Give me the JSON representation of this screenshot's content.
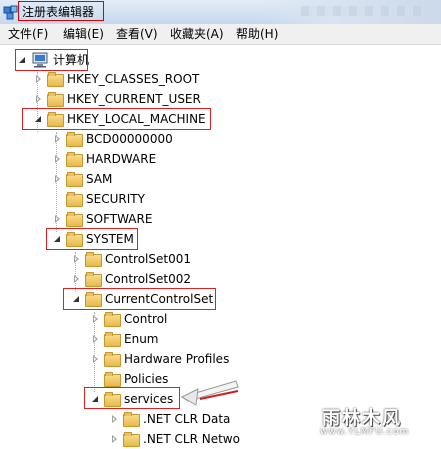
{
  "window": {
    "title": "注册表编辑器"
  },
  "menu": {
    "file": "文件(F)",
    "edit": "编辑(E)",
    "view": "查看(V)",
    "favorites": "收藏夹(A)",
    "help": "帮助(H)"
  },
  "tree": {
    "root": "计算机",
    "hkcr": "HKEY_CLASSES_ROOT",
    "hkcu": "HKEY_CURRENT_USER",
    "hklm": "HKEY_LOCAL_MACHINE",
    "hklm_children": {
      "bcd": "BCD00000000",
      "hardware": "HARDWARE",
      "sam": "SAM",
      "security": "SECURITY",
      "software": "SOFTWARE",
      "system": "SYSTEM"
    },
    "system_children": {
      "cs001": "ControlSet001",
      "cs002": "ControlSet002",
      "ccs": "CurrentControlSet"
    },
    "ccs_children": {
      "control": "Control",
      "enum": "Enum",
      "hwprofiles": "Hardware Profiles",
      "policies": "Policies",
      "services": "services"
    },
    "services_children": {
      "netclr_data": ".NET CLR Data",
      "netclr_network": ".NET CLR Netwo"
    }
  },
  "watermark": {
    "main": "雨林木风",
    "url": "www.YLMFU.com"
  }
}
